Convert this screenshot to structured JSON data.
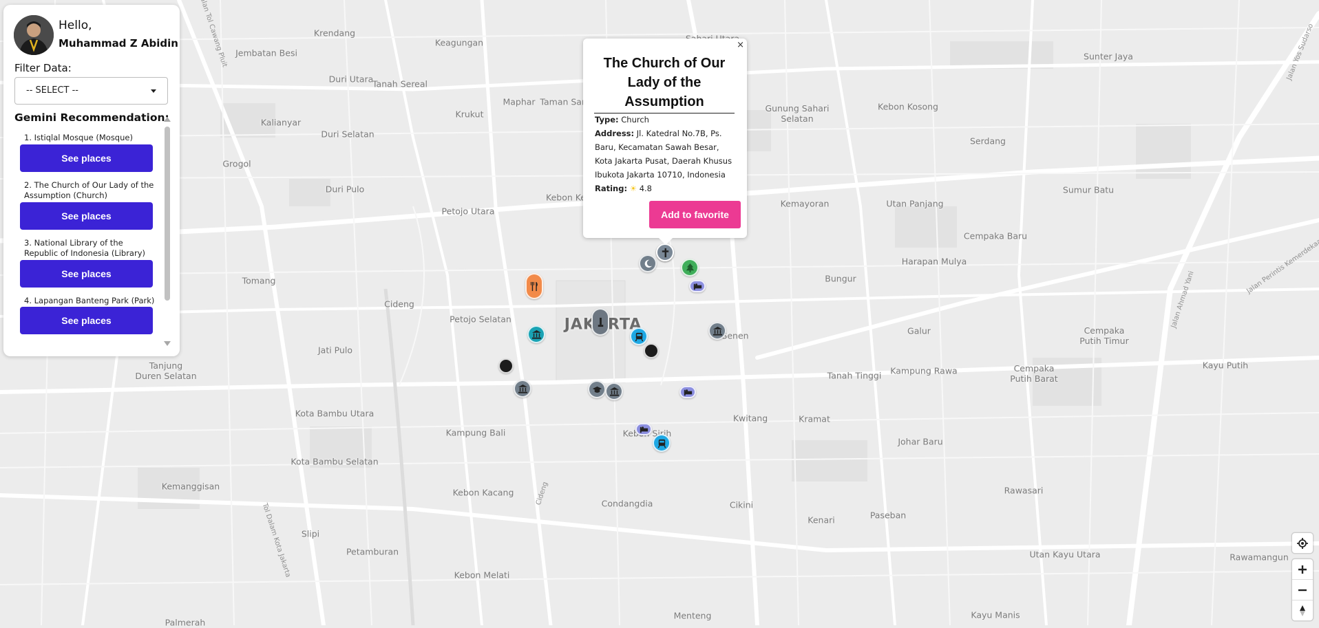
{
  "user": {
    "greeting": "Hello,",
    "name": "Muhammad Z Abidin"
  },
  "filter": {
    "label": "Filter Data:",
    "selected": "-- SELECT --"
  },
  "recommendation": {
    "title": "Gemini Recommendation:",
    "items": [
      {
        "label": "1. Istiqlal Mosque (Mosque)",
        "button": "See places"
      },
      {
        "label": "2. The Church of Our Lady of the Assumption (Church)",
        "button": "See places"
      },
      {
        "label": "3. National Library of the Republic of Indonesia (Library)",
        "button": "See places"
      },
      {
        "label": "4. Lapangan Banteng Park (Park)",
        "button": "See places"
      }
    ]
  },
  "popup": {
    "close": "×",
    "title": "The Church of Our Lady of the Assumption",
    "type_label": "Type:",
    "type": "Church",
    "address_label": "Address:",
    "address": "Jl. Katedral No.7B, Ps. Baru, Kecamatan Sawah Besar, Kota Jakarta Pusat, Daerah Khusus Ibukota Jakarta 10710, Indonesia",
    "rating_label": "Rating:",
    "rating": "4.8",
    "favorite_button": "Add to favorite"
  },
  "map": {
    "city": "JAKARTA",
    "places": [
      "Krendang",
      "Keagungan",
      "Jembatan Besi",
      "Duri Utara",
      "Tanah Sereal",
      "Maphar",
      "Taman Sari",
      "Krukut",
      "Kalianyar",
      "Duri Selatan",
      "Grogol",
      "Duri Pulo",
      "Petojo Utara",
      "Kebon Ke",
      "Tomang",
      "Cideng",
      "Petojo Selatan",
      "Jati Pulo",
      "Tanjung Duren Selatan",
      "Kota Bambu Utara",
      "Kampung Bali",
      "Kota Bambu Selatan",
      "Kemanggisan",
      "Kebon Kacang",
      "Condangdia",
      "Slipi",
      "Petamburan",
      "Kebon Melati",
      "Menteng",
      "Palmerah",
      "Sunter Jaya",
      "Gunung Sahari Selatan",
      "Kebon Kosong",
      "Serdang",
      "Kemayoran",
      "Utan Panjang",
      "Sumur Batu",
      "Cempaka Baru",
      "Harapan Mulya",
      "Bungur",
      "Senen",
      "Galur",
      "Cempaka Putih Timur",
      "Tanah Tinggi",
      "Kampung Rawa",
      "Cempaka Putih Barat",
      "Kayu Putih",
      "Kwitang",
      "Kramat",
      "Johar Baru",
      "Kebon Sirih",
      "Rawasari",
      "Kenari",
      "Paseban",
      "Cikini",
      "Utan Kayu Utara",
      "Rawamangun",
      "Kayu Manis",
      "Sahari Utara"
    ],
    "streets": [
      "Jalan Yos Sudarso",
      "Jalan Perintis Kemerdekaan",
      "Jalan Ahmad Yani",
      "Tol Dalam Kota Jakarta",
      "Jalan Tol Cawang Pluit",
      "Cideng"
    ]
  },
  "marker_icons": {
    "church": "cross-icon",
    "mosque": "crescent-icon",
    "park": "tree-icon",
    "hotel": "bed-icon",
    "museum": "museum-icon",
    "train": "train-icon",
    "restaurant": "restaurant-icon",
    "school": "graduation-cap-icon",
    "monument": "monument-icon"
  },
  "colors": {
    "primary_button": "#3b23d6",
    "favorite_button": "#ec3a93",
    "rating_star": "#f5c518",
    "map_background": "#ececec"
  }
}
